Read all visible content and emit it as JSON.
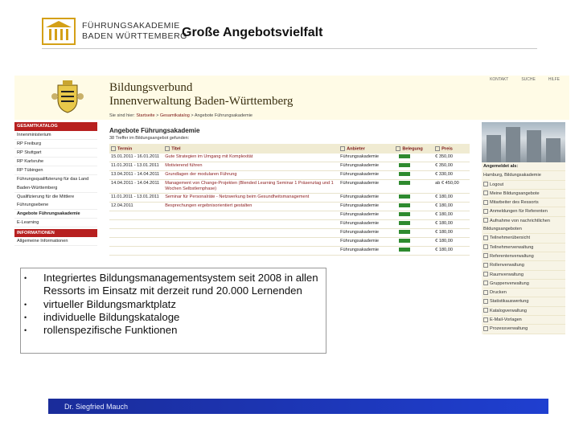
{
  "header": {
    "logo_line1": "FÜHRUNGSAKADEMIE",
    "logo_line2": "BADEN WÜRTTEMBERG",
    "slide_title": "Große Angebotsvielfalt"
  },
  "site": {
    "title_line1": "Bildungsverbund",
    "title_line2": "Innenverwaltung Baden-Württemberg",
    "topnav": [
      "KONTAKT",
      "SUCHE",
      "HILFE"
    ],
    "breadcrumb_prefix": "Sie sind hier:",
    "breadcrumb": [
      "Startseite",
      "Gesamtkatalog",
      "Angebote Führungsakademie"
    ]
  },
  "left_nav": {
    "heading": "GESAMTKATALOG",
    "items": [
      "Innenministerium",
      "RP Freiburg",
      "RP Stuttgart",
      "RP Karlsruhe",
      "RP Tübingen",
      "Führungsqualifizierung für das Land Baden-Württemberg",
      "Qualifizierung für die Mittlere Führungsebene",
      "Angebote Führungsakademie",
      "E-Learning"
    ],
    "bold_index": 7,
    "heading2": "INFORMATIONEN",
    "items2": [
      "Allgemeine Informationen"
    ]
  },
  "results": {
    "heading": "Angebote Führungsakademie",
    "hits": "38 Treffer im Bildungsangebot gefunden:",
    "columns": [
      "Termin",
      "Titel",
      "Anbieter",
      "Belegung",
      "Preis"
    ],
    "rows": [
      {
        "date": "15.01.2011 - 16.01.2011",
        "title": "Gute Strategien im Umgang mit Komplexität",
        "provider": "Führungsakademie",
        "price": "€ 350,00"
      },
      {
        "date": "11.01.2011 - 13.01.2011",
        "title": "Motivierend führen",
        "provider": "Führungsakademie",
        "price": "€ 350,00"
      },
      {
        "date": "13.04.2011 - 14.04.2011",
        "title": "Grundlagen der modularen Führung",
        "provider": "Führungsakademie",
        "price": "€ 330,00"
      },
      {
        "date": "14.04.2011 - 14.04.2011",
        "title": "Management von Change-Projekten (Blended Learning Seminar 1 Präsenztag und 1 Wochen Selbstlernphase)",
        "provider": "Führungsakademie",
        "price": "ab € 450,00"
      },
      {
        "date": "11.01.2011 - 13.01.2011",
        "title": "Seminar für Personalräte - Netzwerkung beim Gesundheitsmanagement",
        "provider": "Führungsakademie",
        "price": "€ 180,00"
      },
      {
        "date": "12.04.2011",
        "title": "Besprechungen ergebnisorientiert gestalten",
        "provider": "Führungsakademie",
        "price": "€ 180,00"
      },
      {
        "date": "",
        "title": "",
        "provider": "Führungsakademie",
        "price": "€ 180,00"
      },
      {
        "date": "",
        "title": "",
        "provider": "Führungsakademie",
        "price": "€ 180,00"
      },
      {
        "date": "",
        "title": "",
        "provider": "Führungsakademie",
        "price": "€ 180,00"
      },
      {
        "date": "",
        "title": "",
        "provider": "Führungsakademie",
        "price": "€ 180,00"
      },
      {
        "date": "",
        "title": "",
        "provider": "Führungsakademie",
        "price": "€ 180,00"
      }
    ]
  },
  "right_side": {
    "label": "Angemeldet als:",
    "user": "Hamburg, Bildungsakademie",
    "items": [
      "Logout",
      "Meine Bildungsangebote",
      "Mitarbeiter des Ressorts",
      "Anmeldungen für Referenten",
      "Aufnahme von nachrichtlichen Bildungsangeboten",
      "Teilnehmerübersicht",
      "Teilnehmerverwaltung",
      "Referentenverwaltung",
      "Rollenverwaltung",
      "Raumverwaltung",
      "Gruppenverwaltung",
      "Drucken",
      "Statistikauswertung",
      "Katalogverwaltung",
      "E-Mail-Vorlagen",
      "Prozessverwaltung"
    ]
  },
  "bullets": [
    "Integriertes Bildungsmanagementsystem seit 2008 in allen Ressorts im Einsatz mit derzeit rund 20.000 Lernenden",
    "virtueller Bildungsmarktplatz",
    "individuelle Bildungskataloge",
    "rollenspezifische Funktionen"
  ],
  "footer": {
    "author": "Dr. Siegfried Mauch"
  },
  "colors": {
    "nav_red": "#b72020",
    "footer_blue": "#1f3fd0",
    "logo_gold": "#d4a017"
  }
}
